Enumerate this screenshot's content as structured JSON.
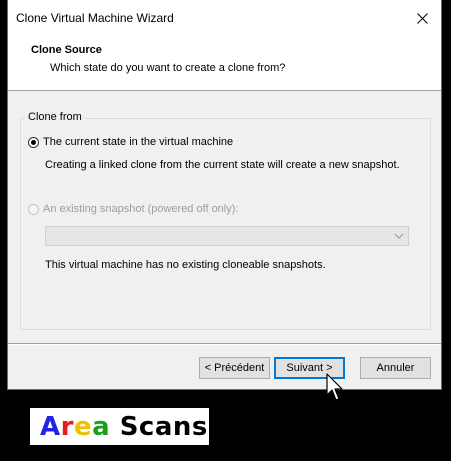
{
  "window": {
    "title": "Clone Virtual Machine Wizard"
  },
  "header": {
    "title": "Clone Source",
    "subtitle": "Which state do you want to create a clone from?"
  },
  "clone_from": {
    "label": "Clone from",
    "options": [
      {
        "label": "The current state in the virtual machine",
        "checked": true,
        "enabled": true,
        "description": "Creating a linked clone from the current state will create a new snapshot."
      },
      {
        "label": "An existing snapshot (powered off only):",
        "checked": false,
        "enabled": false,
        "description": "This virtual machine has no existing cloneable snapshots."
      }
    ],
    "snapshot_select": {
      "value": "",
      "enabled": false
    }
  },
  "buttons": {
    "back": "< Précédent",
    "next": "Suivant >",
    "cancel": "Annuler"
  },
  "watermark": {
    "letters": [
      {
        "char": "A",
        "color": "#2323e8"
      },
      {
        "char": "r",
        "color": "#e02020"
      },
      {
        "char": "e",
        "color": "#f0c000"
      },
      {
        "char": "a",
        "color": "#1aa01a"
      }
    ],
    "rest": " Scans"
  }
}
